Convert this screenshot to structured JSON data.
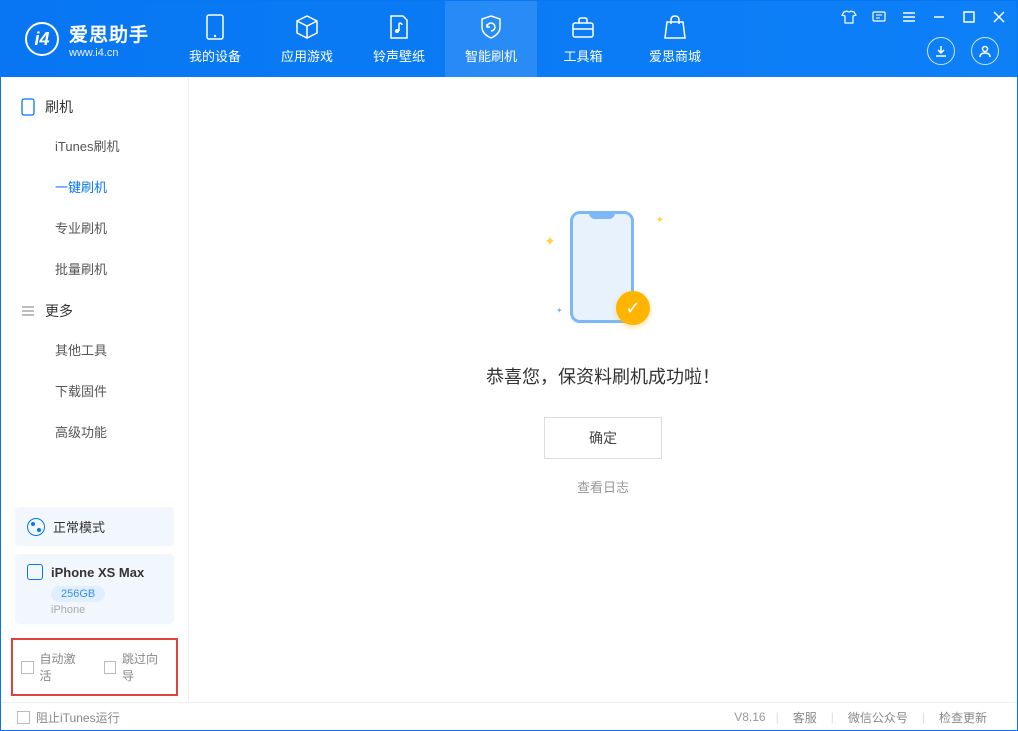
{
  "app": {
    "name_cn": "爱思助手",
    "url": "www.i4.cn"
  },
  "nav": {
    "items": [
      {
        "label": "我的设备"
      },
      {
        "label": "应用游戏"
      },
      {
        "label": "铃声壁纸"
      },
      {
        "label": "智能刷机"
      },
      {
        "label": "工具箱"
      },
      {
        "label": "爱思商城"
      }
    ]
  },
  "sidebar": {
    "section1": {
      "title": "刷机",
      "items": [
        "iTunes刷机",
        "一键刷机",
        "专业刷机",
        "批量刷机"
      ]
    },
    "section2": {
      "title": "更多",
      "items": [
        "其他工具",
        "下载固件",
        "高级功能"
      ]
    },
    "mode": {
      "label": "正常模式"
    },
    "device": {
      "name": "iPhone XS Max",
      "storage": "256GB",
      "type": "iPhone"
    },
    "checks": {
      "auto_activate": "自动激活",
      "skip_guide": "跳过向导"
    }
  },
  "main": {
    "success_msg": "恭喜您，保资料刷机成功啦！",
    "ok_btn": "确定",
    "log_link": "查看日志"
  },
  "footer": {
    "block_itunes": "阻止iTunes运行",
    "version": "V8.16",
    "items": [
      "客服",
      "微信公众号",
      "检查更新"
    ]
  }
}
